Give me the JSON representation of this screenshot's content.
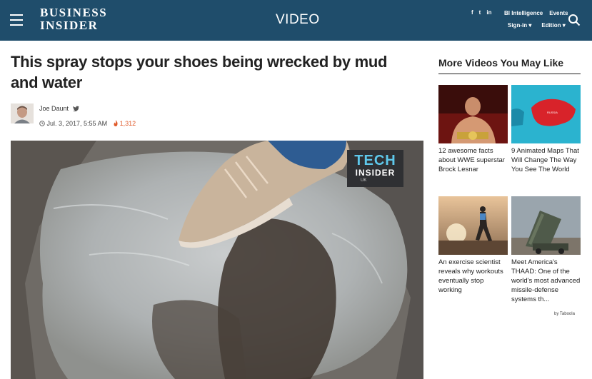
{
  "header": {
    "logo_line1": "BUSINESS",
    "logo_line2": "INSIDER",
    "section": "VIDEO",
    "social": [
      "f",
      "t",
      "in"
    ],
    "links": [
      "BI Intelligence",
      "Events"
    ],
    "signin": "Sign-in",
    "edition": "Edition"
  },
  "article": {
    "headline": "This spray stops your shoes being wrecked by mud and water",
    "author": "Joe Daunt",
    "date": "Jul. 3, 2017, 5:55 AM",
    "views": "1,312"
  },
  "video": {
    "badge_line1": "TECH",
    "badge_line2": "INSIDER",
    "badge_line3": "UK"
  },
  "sidebar": {
    "title": "More Videos You May Like",
    "cards": [
      {
        "text": "12 awesome facts about WWE superstar Brock Lesnar"
      },
      {
        "text": "9 Animated Maps That Will Change The Way You See The World"
      },
      {
        "text": "An exercise scientist reveals why workouts eventually stop working"
      },
      {
        "text": "Meet America's THAAD: One of the world's most advanced missile-defense systems th..."
      }
    ],
    "map_label": "RUSSIA",
    "sponsor": "by Taboola"
  },
  "colors": {
    "header_bg": "#1f4d6b",
    "accent": "#5ec8eb",
    "views_color": "#e05a2b"
  },
  "icons": [
    "hamburger-icon",
    "search-icon",
    "twitter-icon",
    "clock-icon",
    "flame-icon",
    "chevron-down-icon"
  ]
}
